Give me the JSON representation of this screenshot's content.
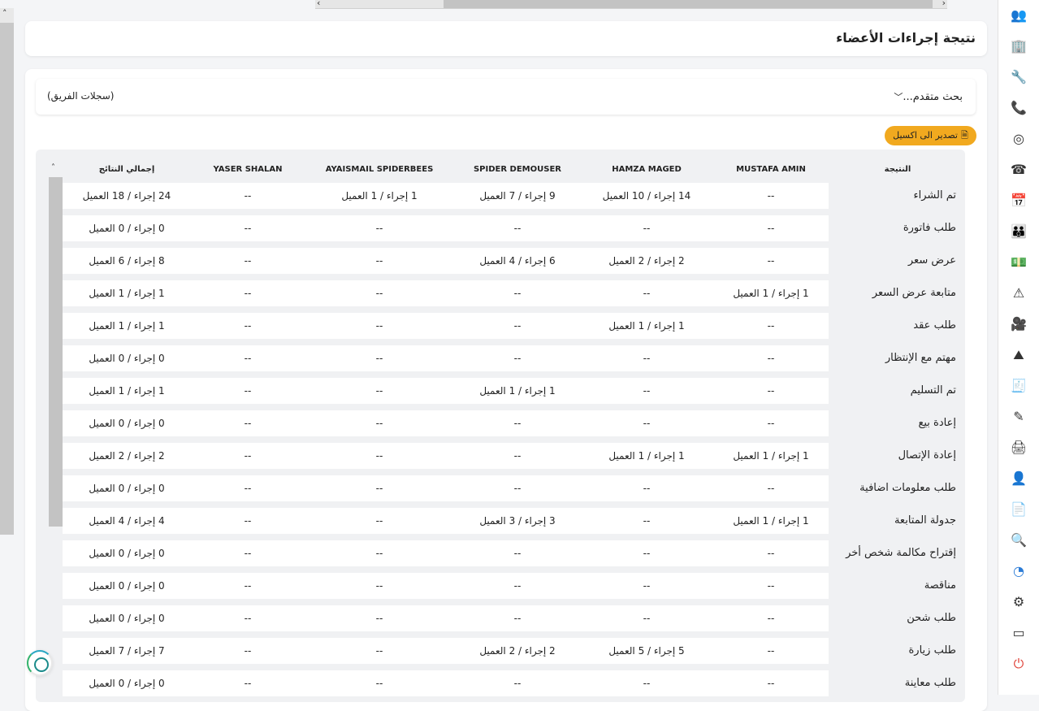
{
  "header": {
    "title": "نتيجة إجراءات الأعضاء"
  },
  "search": {
    "advanced_label": "بحث متقدم...",
    "team_label": "(سجلات الفريق)"
  },
  "toolbar": {
    "export_label": "تصدير الى اكسيل"
  },
  "table": {
    "columns": [
      "النتيجة",
      "MUSTAFA AMIN",
      "HAMZA MAGED",
      "SPIDER DEMOUSER",
      "AYAISMAIL SPIDERBEES",
      "YASER SHALAN",
      "إجمالي النتائج"
    ],
    "rows": [
      {
        "label": "تم الشراء",
        "cells": [
          "--",
          "14 إجراء / 10 العميل",
          "9 إجراء / 7 العميل",
          "1 إجراء / 1 العميل",
          "--",
          "24 إجراء / 18 العميل"
        ]
      },
      {
        "label": "طلب فاتورة",
        "cells": [
          "--",
          "--",
          "--",
          "--",
          "--",
          "0 إجراء / 0 العميل"
        ]
      },
      {
        "label": "عرض سعر",
        "cells": [
          "--",
          "2 إجراء / 2 العميل",
          "6 إجراء / 4 العميل",
          "--",
          "--",
          "8 إجراء / 6 العميل"
        ]
      },
      {
        "label": "متابعة عرض السعر",
        "cells": [
          "1 إجراء / 1 العميل",
          "--",
          "--",
          "--",
          "--",
          "1 إجراء / 1 العميل"
        ]
      },
      {
        "label": "طلب عقد",
        "cells": [
          "--",
          "1 إجراء / 1 العميل",
          "--",
          "--",
          "--",
          "1 إجراء / 1 العميل"
        ]
      },
      {
        "label": "مهتم مع الإنتظار",
        "cells": [
          "--",
          "--",
          "--",
          "--",
          "--",
          "0 إجراء / 0 العميل"
        ]
      },
      {
        "label": "تم التسليم",
        "cells": [
          "--",
          "--",
          "1 إجراء / 1 العميل",
          "--",
          "--",
          "1 إجراء / 1 العميل"
        ]
      },
      {
        "label": "إعادة بيع",
        "cells": [
          "--",
          "--",
          "--",
          "--",
          "--",
          "0 إجراء / 0 العميل"
        ]
      },
      {
        "label": "إعادة الإتصال",
        "cells": [
          "1 إجراء / 1 العميل",
          "1 إجراء / 1 العميل",
          "--",
          "--",
          "--",
          "2 إجراء / 2 العميل"
        ]
      },
      {
        "label": "طلب معلومات اضافية",
        "cells": [
          "--",
          "--",
          "--",
          "--",
          "--",
          "0 إجراء / 0 العميل"
        ]
      },
      {
        "label": "جدولة المتابعة",
        "cells": [
          "1 إجراء / 1 العميل",
          "--",
          "3 إجراء / 3 العميل",
          "--",
          "--",
          "4 إجراء / 4 العميل"
        ]
      },
      {
        "label": "إقتراح مكالمة شخص أخر",
        "cells": [
          "--",
          "--",
          "--",
          "--",
          "--",
          "0 إجراء / 0 العميل"
        ]
      },
      {
        "label": "مناقصة",
        "cells": [
          "--",
          "--",
          "--",
          "--",
          "--",
          "0 إجراء / 0 العميل"
        ]
      },
      {
        "label": "طلب شحن",
        "cells": [
          "--",
          "--",
          "--",
          "--",
          "--",
          "0 إجراء / 0 العميل"
        ]
      },
      {
        "label": "طلب زيارة",
        "cells": [
          "--",
          "5 إجراء / 5 العميل",
          "2 إجراء / 2 العميل",
          "--",
          "--",
          "7 إجراء / 7 العميل"
        ]
      },
      {
        "label": "طلب معاينة",
        "cells": [
          "--",
          "--",
          "--",
          "--",
          "--",
          "0 إجراء / 0 العميل"
        ]
      }
    ]
  },
  "sidebar": {
    "icons": [
      "users-icon",
      "building-icon",
      "tools-icon",
      "phone-call-icon",
      "target-icon",
      "telephone-icon",
      "calendar-settings-icon",
      "team-icon",
      "money-icon",
      "warning-icon",
      "video-icon",
      "mountain-icon",
      "invoice-icon",
      "pen-icon",
      "printer-icon",
      "user-settings-icon",
      "add-document-icon",
      "document-search-icon",
      "chart-icon",
      "settings-icon",
      "screen-icon",
      "power-icon"
    ],
    "accent": "#2a7bd6",
    "power_color": "#e0453b"
  }
}
